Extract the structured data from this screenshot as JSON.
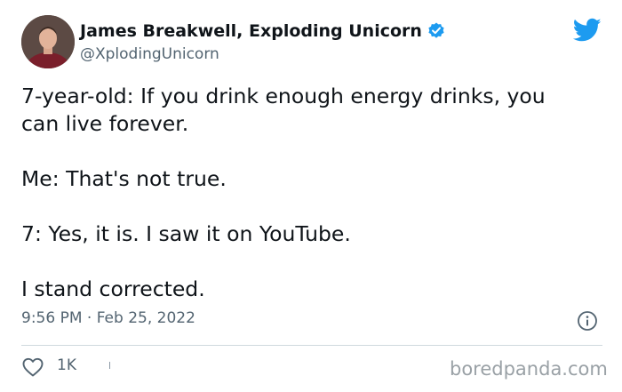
{
  "author": {
    "name": "James Breakwell, Exploding Unicorn",
    "handle": "@XplodingUnicorn",
    "verified_icon": "verified-badge-icon",
    "avatar_icon": "profile-photo"
  },
  "platform_icon": "twitter-bird-icon",
  "tweet": {
    "paragraphs": [
      "7-year-old: If you drink enough energy drinks, you",
      "can live forever.",
      "Me: That's not true.",
      "7: Yes, it is. I saw it on YouTube.",
      "I stand corrected."
    ],
    "timestamp": "9:56 PM · Feb 25, 2022"
  },
  "actions": {
    "like_count": "1K",
    "like_icon": "heart-icon",
    "info_icon": "info-icon"
  },
  "watermark": "boredpanda.com",
  "colors": {
    "brand": "#1d9bf0",
    "text": "#0f1419",
    "secondary_text": "#536471",
    "divider": "#cfd9de"
  }
}
